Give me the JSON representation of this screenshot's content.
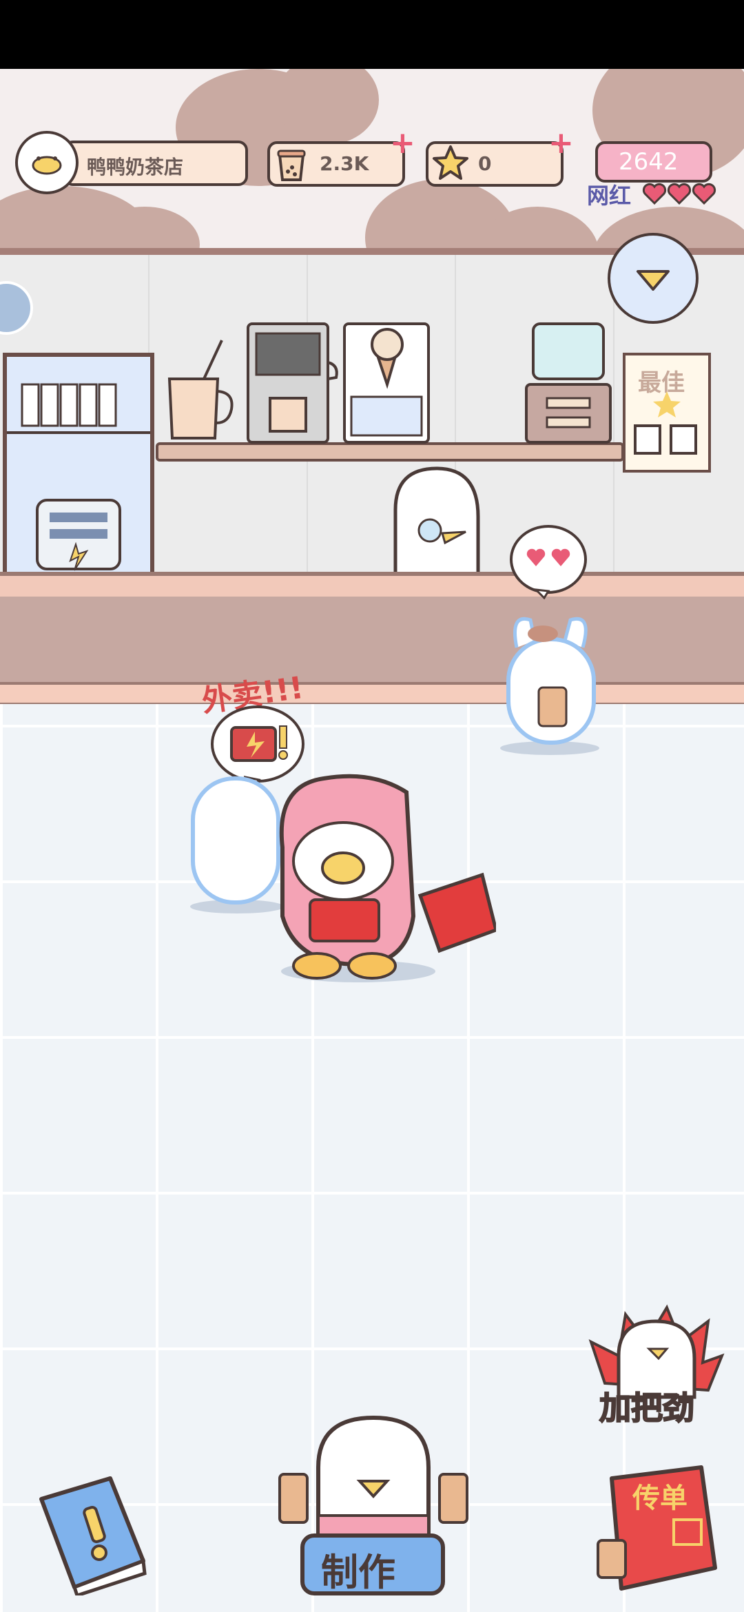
{
  "hud": {
    "shop_name": "鸭鸭奶茶店",
    "milk_tea_count": "2.3K",
    "star_count": "0",
    "popularity_value": "2642",
    "popularity_label": "网红"
  },
  "shelf": {
    "best_sign": "最佳"
  },
  "bubbles": {
    "delivery_label": "外卖!!!"
  },
  "buttons": {
    "cheer_label": "加把劲",
    "make_label": "制作",
    "flyer_label": "传单"
  },
  "colors": {
    "wall": "#f4eeee",
    "cloud": "#c9aaa2",
    "counter": "#c6a8a1",
    "floor": "#f0f4f8",
    "accent_pink": "#e95b76",
    "outline": "#4a3a37"
  }
}
